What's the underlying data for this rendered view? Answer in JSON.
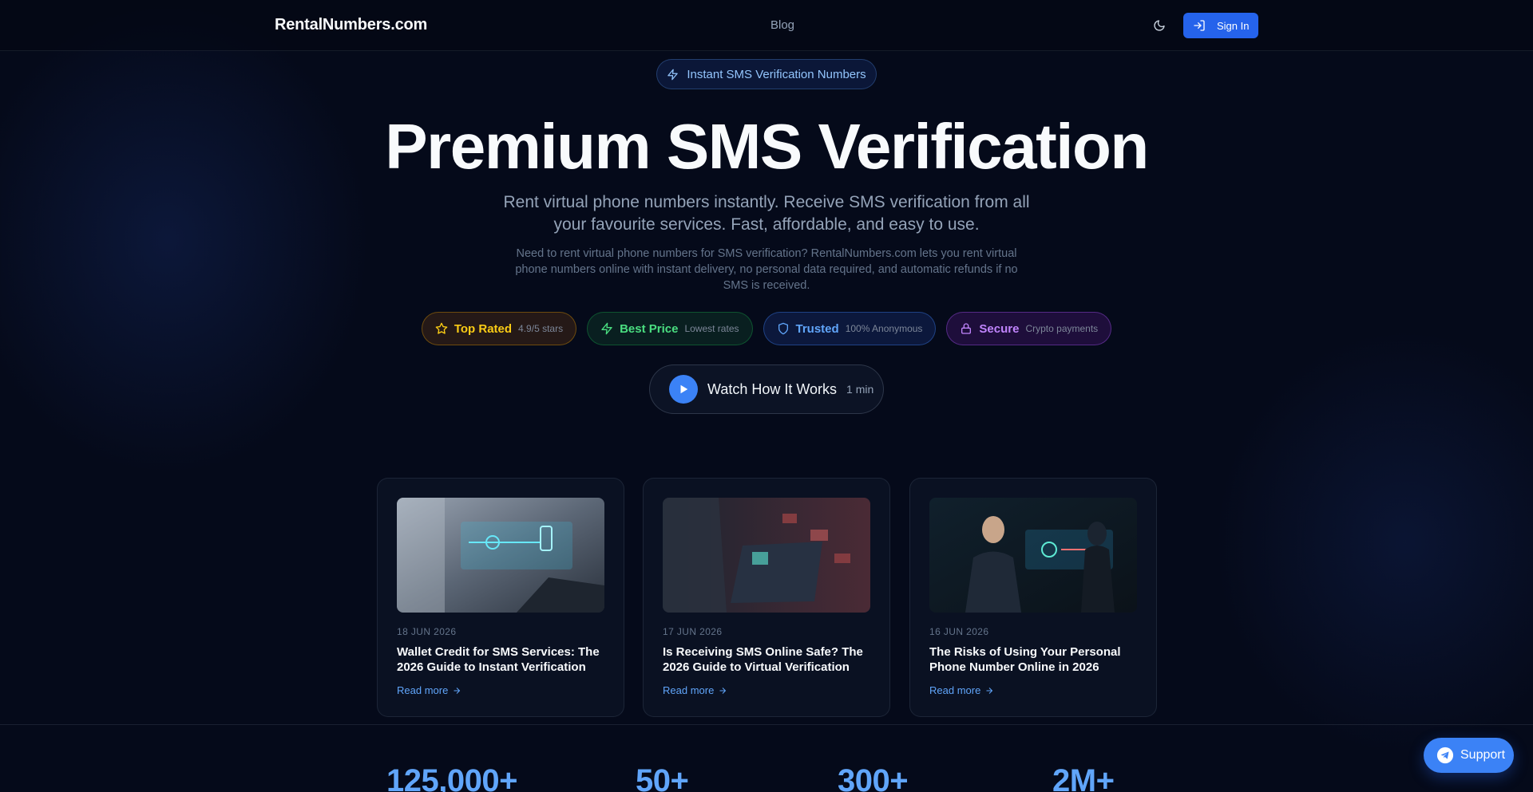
{
  "header": {
    "logo": "RentalNumbers.com",
    "nav_blog": "Blog",
    "theme_icon": "moon-icon",
    "signin_icon": "login-icon",
    "signin_label": "Sign In"
  },
  "hero": {
    "pill_icon": "lightning-icon",
    "pill_label": "Instant SMS Verification Numbers",
    "title": "Premium SMS Verification",
    "subtitle": "Rent virtual phone numbers instantly. Receive SMS verification from all your favourite services. Fast, affordable, and easy to use.",
    "description": "Need to rent virtual phone numbers for SMS verification? RentalNumbers.com lets you rent virtual phone numbers online with instant delivery, no personal data required, and automatic refunds if no SMS is received.",
    "badges": [
      {
        "icon": "star-icon",
        "title": "Top Rated",
        "sub": "4.9/5 stars",
        "color": "#facc15"
      },
      {
        "icon": "lightning-icon",
        "title": "Best Price",
        "sub": "Lowest rates",
        "color": "#4ade80"
      },
      {
        "icon": "shield-icon",
        "title": "Trusted",
        "sub": "100% Anonymous",
        "color": "#60a5fa"
      },
      {
        "icon": "lock-icon",
        "title": "Secure",
        "sub": "Crypto payments",
        "color": "#c084fc"
      }
    ],
    "watch_label": "Watch How It Works",
    "watch_duration": "1 min"
  },
  "posts": [
    {
      "date": "18 JUN 2026",
      "title": "Wallet Credit for SMS Services: The 2026 Guide to Instant Verification",
      "read_more": "Read more"
    },
    {
      "date": "17 JUN 2026",
      "title": "Is Receiving SMS Online Safe? The 2026 Guide to Virtual Verification",
      "read_more": "Read more"
    },
    {
      "date": "16 JUN 2026",
      "title": "The Risks of Using Your Personal Phone Number Online in 2026",
      "read_more": "Read more"
    }
  ],
  "stats": [
    "125,000+",
    "50+",
    "300+",
    "2M+"
  ],
  "support": {
    "icon": "telegram-icon",
    "label": "Support"
  },
  "colors": {
    "accent": "#3b82f6",
    "background": "#050a1a"
  }
}
